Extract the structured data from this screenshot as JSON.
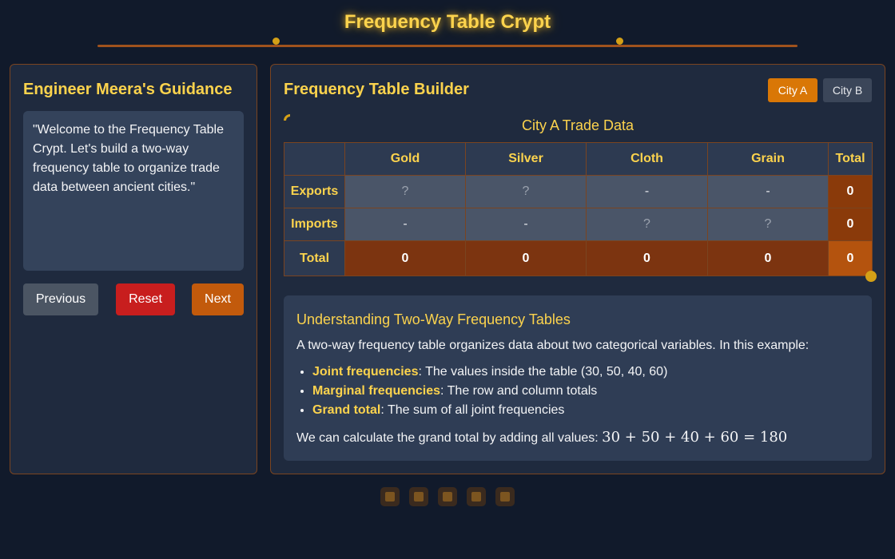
{
  "header": {
    "title": "Frequency Table Crypt"
  },
  "guide": {
    "heading": "Engineer Meera's Guidance",
    "message": "\"Welcome to the Frequency Table Crypt. Let's build a two-way frequency table to organize trade data between ancient cities.\"",
    "buttons": {
      "previous": "Previous",
      "reset": "Reset",
      "next": "Next"
    }
  },
  "builder": {
    "heading": "Frequency Table Builder",
    "city_tabs": [
      "City A",
      "City B"
    ],
    "active_city": "City A",
    "caption": "City A Trade Data",
    "columns": [
      "",
      "Gold",
      "Silver",
      "Cloth",
      "Grain",
      "Total"
    ],
    "rows": [
      {
        "label": "Exports",
        "cells": [
          "?",
          "?",
          "-",
          "-"
        ],
        "total": "0"
      },
      {
        "label": "Imports",
        "cells": [
          "-",
          "-",
          "?",
          "?"
        ],
        "total": "0"
      },
      {
        "label": "Total",
        "cells": [
          "0",
          "0",
          "0",
          "0"
        ],
        "total": "0"
      }
    ]
  },
  "explanation": {
    "title": "Understanding Two-Way Frequency Tables",
    "intro": "A two-way frequency table organizes data about two categorical variables. In this example:",
    "items": [
      {
        "term": "Joint frequencies",
        "text": ": The values inside the table (30, 50, 40, 60)"
      },
      {
        "term": "Marginal frequencies",
        "text": ": The row and column totals"
      },
      {
        "term": "Grand total",
        "text": ": The sum of all joint frequencies"
      }
    ],
    "calc_text": "We can calculate the grand total by adding all values: ",
    "calc_math": "30 + 50 + 40 + 60 = 180"
  },
  "colors": {
    "accent": "#fcd34d",
    "border": "#7a4420",
    "active_tab": "#d97706"
  }
}
